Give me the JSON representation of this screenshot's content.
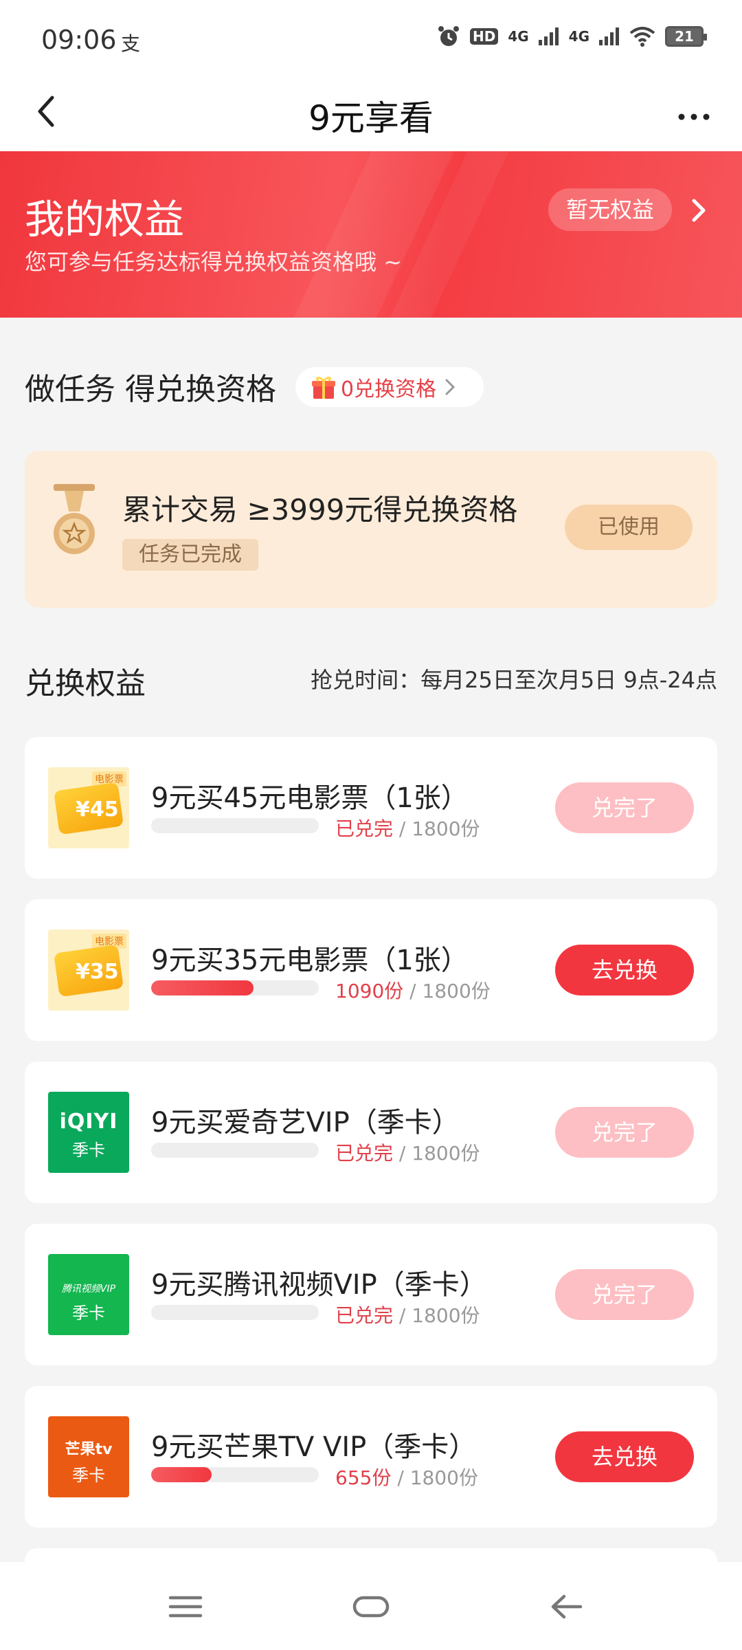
{
  "status_bar": {
    "time": "09:06",
    "sim_icon": "支",
    "icons": [
      "alarm-icon",
      "hd-icon",
      "signal-4g-icon",
      "signal-4g-icon",
      "wifi-icon"
    ],
    "hd_label": "HD",
    "net1": "4G",
    "net2": "4G",
    "battery": "21"
  },
  "nav": {
    "title": "9元享看"
  },
  "banner": {
    "title": "我的权益",
    "subtitle": "您可参与任务达标得兑换权益资格哦 ~",
    "pill": "暂无权益",
    "color": "#f0373d"
  },
  "tasks": {
    "heading": "做任务 得兑换资格",
    "chip": "0兑换资格",
    "card": {
      "text": "累计交易 ≥3999元得兑换资格",
      "badge": "任务已完成",
      "button": "已使用"
    }
  },
  "exchange": {
    "heading": "兑换权益",
    "time": "抢兑时间：每月25日至次月5日 9点-24点",
    "items": [
      {
        "thumb": "movie-ticket-45",
        "thumb_tag": "电影票",
        "thumb_num": "¥45",
        "name": "9元买45元电影票（1张）",
        "stock_value": "已兑完",
        "stock_total": " / 1800份",
        "progress": 0,
        "button": "兑完了",
        "state": "done"
      },
      {
        "thumb": "movie-ticket-35",
        "thumb_tag": "电影票",
        "thumb_num": "¥35",
        "name": "9元买35元电影票（1张）",
        "stock_value": "1090份",
        "stock_total": " / 1800份",
        "progress": 0.61,
        "button": "去兑换",
        "state": "active"
      },
      {
        "thumb": "iqiyi-logo",
        "thumb_l1": "iQIYI",
        "thumb_l2": "季卡",
        "name": "9元买爱奇艺VIP（季卡）",
        "stock_value": "已兑完",
        "stock_total": " / 1800份",
        "progress": 0,
        "button": "兑完了",
        "state": "done"
      },
      {
        "thumb": "tencent-video-logo",
        "thumb_l1": "腾讯视频VIP",
        "thumb_l2": "季卡",
        "name": "9元买腾讯视频VIP（季卡）",
        "stock_value": "已兑完",
        "stock_total": " / 1800份",
        "progress": 0,
        "button": "兑完了",
        "state": "done"
      },
      {
        "thumb": "mango-tv-logo",
        "thumb_l1": "芒果tv",
        "thumb_l2": "季卡",
        "name": "9元买芒果TV VIP（季卡）",
        "stock_value": "655份",
        "stock_total": " / 1800份",
        "progress": 0.36,
        "button": "去兑换",
        "state": "active"
      }
    ]
  },
  "colors": {
    "accent": "#f2363f",
    "done": "#fdbfc3",
    "task_card": "#fdecd9"
  },
  "system_nav": [
    "menu-icon",
    "home-icon",
    "back-icon"
  ]
}
